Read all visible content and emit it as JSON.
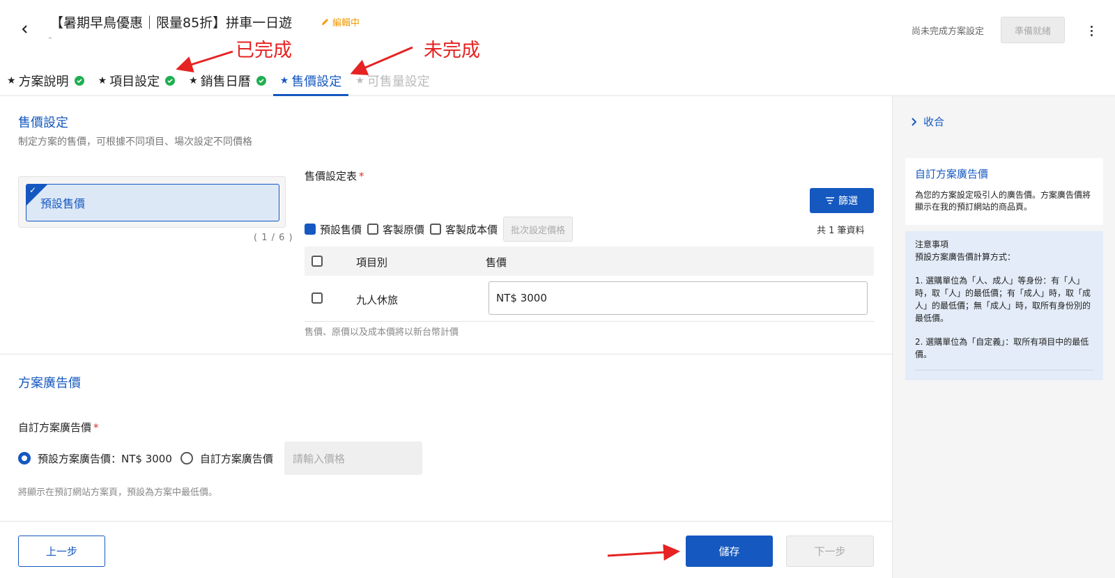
{
  "header": {
    "title": "【暑期早鳥優惠｜限量85折】拼車一日遊",
    "edit_status": "編輯中",
    "setup_status": "尚未完成方案設定",
    "ready_button": "準備就緒"
  },
  "annotations": {
    "done": "已完成",
    "not_done": "未完成"
  },
  "tabs": [
    {
      "label": "方案說明",
      "state": "done"
    },
    {
      "label": "項目設定",
      "state": "done"
    },
    {
      "label": "銷售日曆",
      "state": "done"
    },
    {
      "label": "售價設定",
      "state": "active"
    },
    {
      "label": "可售量設定",
      "state": "disabled"
    }
  ],
  "pricing": {
    "title": "售價設定",
    "description": "制定方案的售價，可根據不同項目、場次設定不同價格",
    "plan_item": "預設售價",
    "plan_count": "( 1 / 6 )",
    "table_label": "售價設定表",
    "filter_button": "篩選",
    "options": [
      "預設售價",
      "客製原價",
      "客製成本價"
    ],
    "batch_button": "批次設定價格",
    "total": "共 1 筆資料",
    "columns": [
      "項目別",
      "售價"
    ],
    "rows": [
      {
        "item": "九人休旅",
        "price": "NT$ 3000"
      }
    ],
    "note": "售價、原價以及成本價將以新台幣計價"
  },
  "advert": {
    "title": "方案廣告價",
    "label": "自訂方案廣告價",
    "option_default": "預設方案廣告價：NT$ 3000",
    "option_custom": "自訂方案廣告價",
    "input_placeholder": "請輸入價格",
    "note": "將顯示在預訂網站方案頁，預設為方案中最低價。"
  },
  "footer": {
    "prev": "上一步",
    "save": "儲存",
    "next": "下一步"
  },
  "sidebar": {
    "collapse": "收合",
    "card_title": "自訂方案廣告價",
    "card_text": "為您的方案設定吸引人的廣告價。方案廣告價將顯示在我的預訂網站的商品頁。",
    "note_title": "注意事項",
    "note_sub": "預設方案廣告價計算方式：",
    "note_1": "1. 選購單位為「人、成人」等身份：有「人」時，取「人」的最低價；有「成人」時，取「成人」的最低價；無「成人」時，取所有身份別的最低價。",
    "note_2": "2. 選購單位為「自定義」：取所有項目中的最低價。"
  },
  "colors": {
    "accent": "#1558c0",
    "success": "#1fae52",
    "warning": "#f29900",
    "annotation": "#e62222"
  }
}
